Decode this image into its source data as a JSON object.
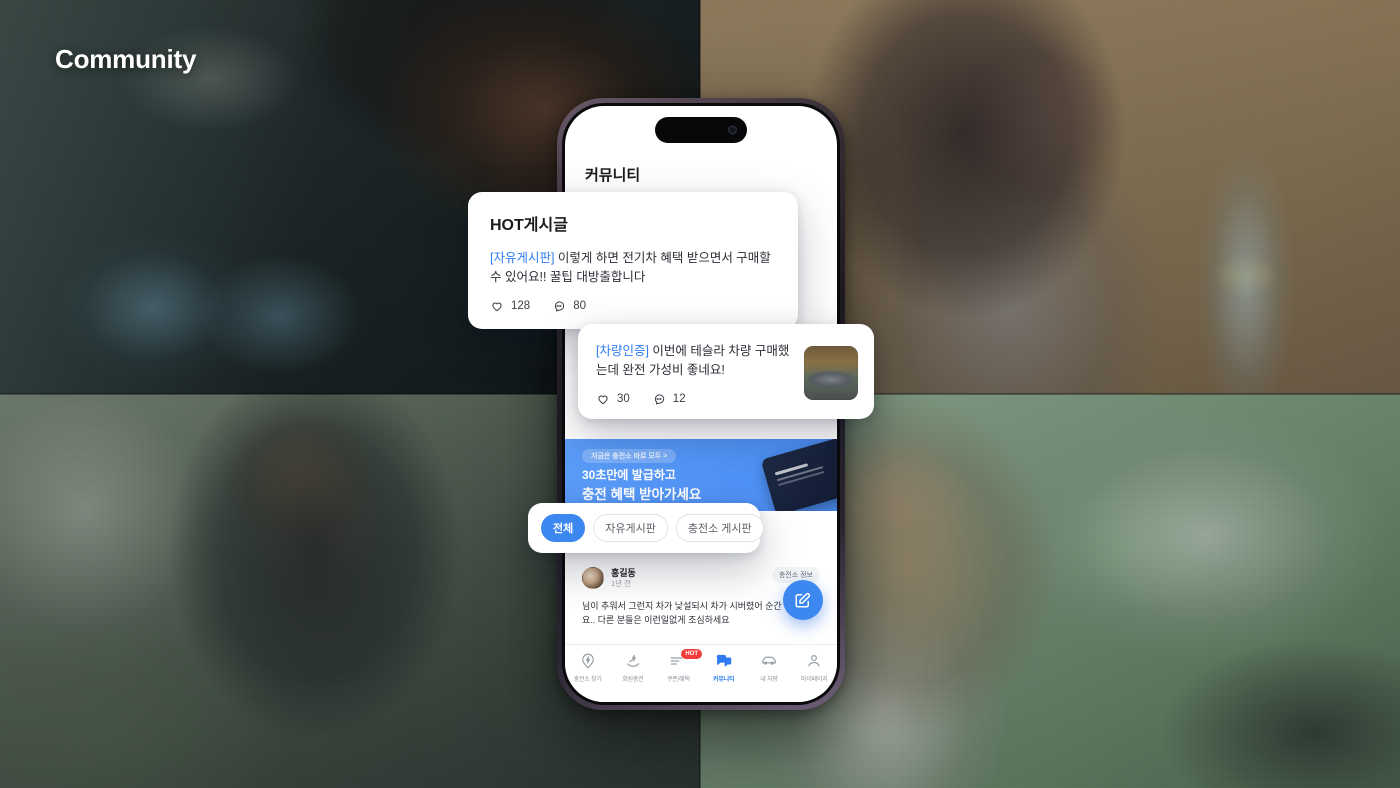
{
  "page": {
    "title": "Community"
  },
  "phone": {
    "screen_title": "커뮤니티",
    "banner": {
      "badge": "지금은 충전소 바로 모두 >",
      "line1": "30초만에 발급하고",
      "line2": "충전 혜택 받아가세요",
      "bg_color": "#5b9cf8"
    },
    "post": {
      "user": "홍길동",
      "time": "1년 전",
      "tag": "충전소 정보",
      "body": "님이 추워서 그런지 차가 낯설되시 차가 시버렸어\n순간 아찔했네요.. 다른 분들은 이런일없게 조심하세요"
    },
    "fab": {
      "name": "write-post",
      "icon": "pencil-square-icon",
      "color": "#3d87f0"
    },
    "bottom_nav": [
      {
        "label": "충전소 찾기",
        "icon": "map-pin-bolt-icon",
        "active": false,
        "badge": ""
      },
      {
        "label": "회원충전",
        "icon": "hand-charge-icon",
        "active": false,
        "badge": ""
      },
      {
        "label": "쿠폰/혜택",
        "icon": "coupon-icon",
        "active": false,
        "badge": "HOT"
      },
      {
        "label": "커뮤니티",
        "icon": "chat-icon",
        "active": true,
        "badge": ""
      },
      {
        "label": "내 차량",
        "icon": "car-icon",
        "active": false,
        "badge": ""
      },
      {
        "label": "마이페이지",
        "icon": "person-icon",
        "active": false,
        "badge": ""
      }
    ]
  },
  "cards": {
    "hot": {
      "title": "HOT게시글",
      "board_tag": "[자유게시판]",
      "text": " 이렇게 하면 전기차 혜택 받으면서 구매할 수 있어요!! 꿀팁 대방출합니다",
      "likes": "128",
      "comments": "80"
    },
    "car": {
      "board_tag": "[차량인증]",
      "text": " 이번에 테슬라 차량 구매했는데 완전 가성비 좋네요!",
      "likes": "30",
      "comments": "12"
    }
  },
  "chips": [
    {
      "label": "전체",
      "active": true
    },
    {
      "label": "자유게시판",
      "active": false
    },
    {
      "label": "충전소 게시판",
      "active": false
    }
  ],
  "colors": {
    "accent": "#3d87f0",
    "banner": "#5b9cf8",
    "hot_badge": "#f23b3b"
  }
}
